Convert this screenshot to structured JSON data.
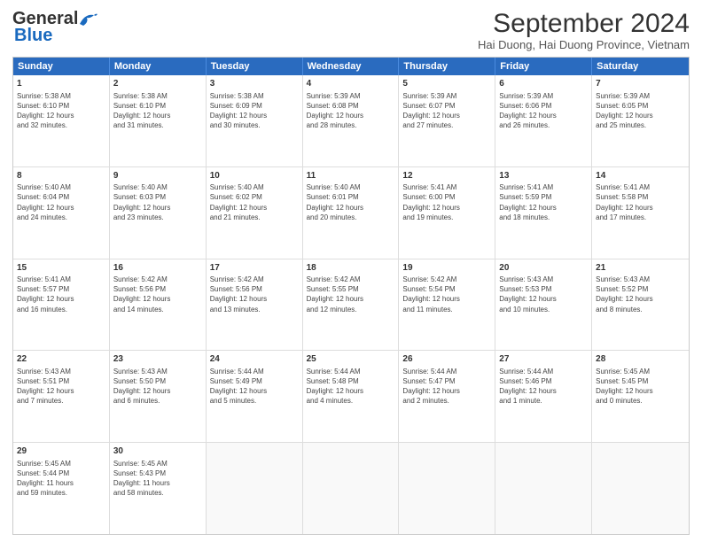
{
  "header": {
    "logo_line1": "General",
    "logo_line2": "Blue",
    "month": "September 2024",
    "location": "Hai Duong, Hai Duong Province, Vietnam"
  },
  "weekdays": [
    "Sunday",
    "Monday",
    "Tuesday",
    "Wednesday",
    "Thursday",
    "Friday",
    "Saturday"
  ],
  "rows": [
    [
      {
        "day": "1",
        "info": "Sunrise: 5:38 AM\nSunset: 6:10 PM\nDaylight: 12 hours\nand 32 minutes."
      },
      {
        "day": "2",
        "info": "Sunrise: 5:38 AM\nSunset: 6:10 PM\nDaylight: 12 hours\nand 31 minutes."
      },
      {
        "day": "3",
        "info": "Sunrise: 5:38 AM\nSunset: 6:09 PM\nDaylight: 12 hours\nand 30 minutes."
      },
      {
        "day": "4",
        "info": "Sunrise: 5:39 AM\nSunset: 6:08 PM\nDaylight: 12 hours\nand 28 minutes."
      },
      {
        "day": "5",
        "info": "Sunrise: 5:39 AM\nSunset: 6:07 PM\nDaylight: 12 hours\nand 27 minutes."
      },
      {
        "day": "6",
        "info": "Sunrise: 5:39 AM\nSunset: 6:06 PM\nDaylight: 12 hours\nand 26 minutes."
      },
      {
        "day": "7",
        "info": "Sunrise: 5:39 AM\nSunset: 6:05 PM\nDaylight: 12 hours\nand 25 minutes."
      }
    ],
    [
      {
        "day": "8",
        "info": "Sunrise: 5:40 AM\nSunset: 6:04 PM\nDaylight: 12 hours\nand 24 minutes."
      },
      {
        "day": "9",
        "info": "Sunrise: 5:40 AM\nSunset: 6:03 PM\nDaylight: 12 hours\nand 23 minutes."
      },
      {
        "day": "10",
        "info": "Sunrise: 5:40 AM\nSunset: 6:02 PM\nDaylight: 12 hours\nand 21 minutes."
      },
      {
        "day": "11",
        "info": "Sunrise: 5:40 AM\nSunset: 6:01 PM\nDaylight: 12 hours\nand 20 minutes."
      },
      {
        "day": "12",
        "info": "Sunrise: 5:41 AM\nSunset: 6:00 PM\nDaylight: 12 hours\nand 19 minutes."
      },
      {
        "day": "13",
        "info": "Sunrise: 5:41 AM\nSunset: 5:59 PM\nDaylight: 12 hours\nand 18 minutes."
      },
      {
        "day": "14",
        "info": "Sunrise: 5:41 AM\nSunset: 5:58 PM\nDaylight: 12 hours\nand 17 minutes."
      }
    ],
    [
      {
        "day": "15",
        "info": "Sunrise: 5:41 AM\nSunset: 5:57 PM\nDaylight: 12 hours\nand 16 minutes."
      },
      {
        "day": "16",
        "info": "Sunrise: 5:42 AM\nSunset: 5:56 PM\nDaylight: 12 hours\nand 14 minutes."
      },
      {
        "day": "17",
        "info": "Sunrise: 5:42 AM\nSunset: 5:56 PM\nDaylight: 12 hours\nand 13 minutes."
      },
      {
        "day": "18",
        "info": "Sunrise: 5:42 AM\nSunset: 5:55 PM\nDaylight: 12 hours\nand 12 minutes."
      },
      {
        "day": "19",
        "info": "Sunrise: 5:42 AM\nSunset: 5:54 PM\nDaylight: 12 hours\nand 11 minutes."
      },
      {
        "day": "20",
        "info": "Sunrise: 5:43 AM\nSunset: 5:53 PM\nDaylight: 12 hours\nand 10 minutes."
      },
      {
        "day": "21",
        "info": "Sunrise: 5:43 AM\nSunset: 5:52 PM\nDaylight: 12 hours\nand 8 minutes."
      }
    ],
    [
      {
        "day": "22",
        "info": "Sunrise: 5:43 AM\nSunset: 5:51 PM\nDaylight: 12 hours\nand 7 minutes."
      },
      {
        "day": "23",
        "info": "Sunrise: 5:43 AM\nSunset: 5:50 PM\nDaylight: 12 hours\nand 6 minutes."
      },
      {
        "day": "24",
        "info": "Sunrise: 5:44 AM\nSunset: 5:49 PM\nDaylight: 12 hours\nand 5 minutes."
      },
      {
        "day": "25",
        "info": "Sunrise: 5:44 AM\nSunset: 5:48 PM\nDaylight: 12 hours\nand 4 minutes."
      },
      {
        "day": "26",
        "info": "Sunrise: 5:44 AM\nSunset: 5:47 PM\nDaylight: 12 hours\nand 2 minutes."
      },
      {
        "day": "27",
        "info": "Sunrise: 5:44 AM\nSunset: 5:46 PM\nDaylight: 12 hours\nand 1 minute."
      },
      {
        "day": "28",
        "info": "Sunrise: 5:45 AM\nSunset: 5:45 PM\nDaylight: 12 hours\nand 0 minutes."
      }
    ],
    [
      {
        "day": "29",
        "info": "Sunrise: 5:45 AM\nSunset: 5:44 PM\nDaylight: 11 hours\nand 59 minutes."
      },
      {
        "day": "30",
        "info": "Sunrise: 5:45 AM\nSunset: 5:43 PM\nDaylight: 11 hours\nand 58 minutes."
      },
      {
        "day": "",
        "info": ""
      },
      {
        "day": "",
        "info": ""
      },
      {
        "day": "",
        "info": ""
      },
      {
        "day": "",
        "info": ""
      },
      {
        "day": "",
        "info": ""
      }
    ]
  ]
}
